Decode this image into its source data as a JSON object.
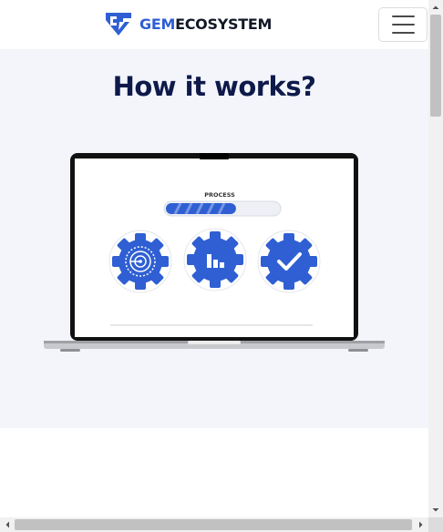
{
  "navbar": {
    "brand_part1": "GEM",
    "brand_part2": "ECOSYSTEM",
    "logo_icon": "gem-shield-logo-icon",
    "menu_icon": "hamburger-menu-icon"
  },
  "hero": {
    "title": "How it works?",
    "illustration": {
      "process_label": "PROCESS",
      "progress": 0.62,
      "icons": [
        "target-gear-icon",
        "bar-chart-gear-icon",
        "checkmark-gear-icon"
      ]
    }
  },
  "colors": {
    "brand_blue": "#2f5fd3",
    "heading_navy": "#0e1a4a",
    "section_bg": "#f3f5fb"
  },
  "scrollbars": {
    "vertical_icons": [
      "scroll-up-arrow-icon",
      "scroll-down-arrow-icon"
    ],
    "horizontal_icons": [
      "scroll-left-arrow-icon",
      "scroll-right-arrow-icon"
    ]
  }
}
